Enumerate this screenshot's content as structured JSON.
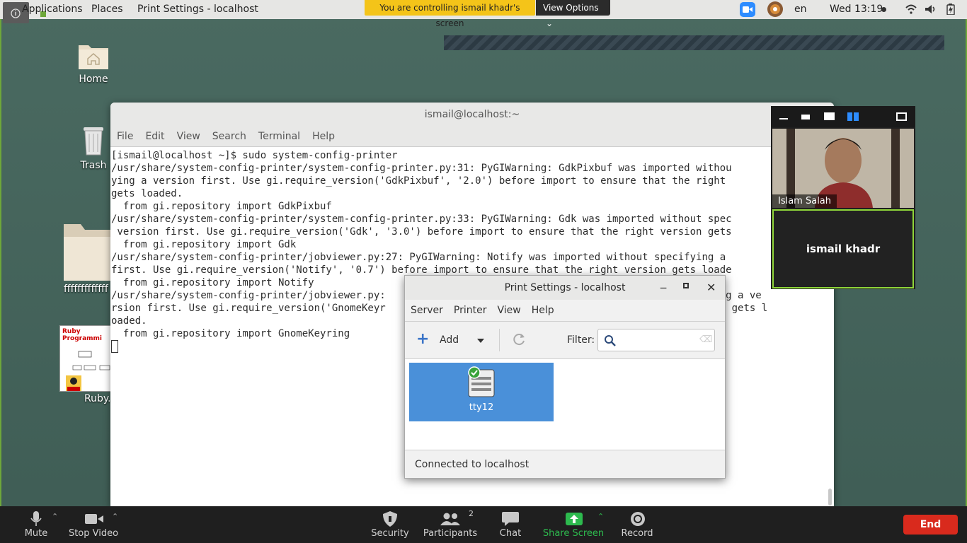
{
  "topbar": {
    "applications": "Applications",
    "places": "Places",
    "active_window": "Print Settings - localhost",
    "banner": "You are controlling ismail khadr's screen",
    "view_options": "View Options",
    "lang": "en",
    "clock": "Wed 13:19"
  },
  "desktop": {
    "icons": [
      {
        "label": "Home"
      },
      {
        "label": "Trash"
      },
      {
        "label": "fffffffffffff"
      },
      {
        "label": "Ruby."
      }
    ],
    "ruby_thumb_title": "Ruby Programmi"
  },
  "terminal": {
    "title": "ismail@localhost:~",
    "menu": [
      "File",
      "Edit",
      "View",
      "Search",
      "Terminal",
      "Help"
    ],
    "lines": [
      "[ismail@localhost ~]$ sudo system-config-printer",
      "/usr/share/system-config-printer/system-config-printer.py:31: PyGIWarning: GdkPixbuf was imported withou",
      "ying a version first. Use gi.require_version('GdkPixbuf', '2.0') before import to ensure that the right",
      "gets loaded.",
      "  from gi.repository import GdkPixbuf",
      "/usr/share/system-config-printer/system-config-printer.py:33: PyGIWarning: Gdk was imported without spec",
      " version first. Use gi.require_version('Gdk', '3.0') before import to ensure that the right version gets",
      "  from gi.repository import Gdk",
      "/usr/share/system-config-printer/jobviewer.py:27: PyGIWarning: Notify was imported without specifying a",
      "first. Use gi.require_version('Notify', '0.7') before import to ensure that the right version gets loade",
      "  from gi.repository import Notify",
      "/usr/share/system-config-printer/jobviewer.py:                                                specifying a ve",
      "rsion first. Use gi.require_version('GnomeKeyr                                                t version gets l",
      "oaded.",
      "  from gi.repository import GnomeKeyring"
    ]
  },
  "dialog": {
    "title": "Print Settings - localhost",
    "menu": [
      "Server",
      "Printer",
      "View",
      "Help"
    ],
    "add_label": "Add",
    "filter_label": "Filter:",
    "printer_name": "tty12",
    "status": "Connected to localhost"
  },
  "zoom": {
    "participant_video_name": "Islam Salah",
    "participant_tile_name": "ismail khadr"
  },
  "bottombar": {
    "mute": "Mute",
    "stop_video": "Stop Video",
    "security": "Security",
    "participants": "Participants",
    "participants_count": "2",
    "chat": "Chat",
    "share_screen": "Share Screen",
    "record": "Record",
    "end": "End"
  },
  "colors": {
    "share_green": "#2dba4e",
    "end_red": "#d92a1d",
    "banner_yellow": "#f4c419",
    "selection_blue": "#4a90d9"
  }
}
